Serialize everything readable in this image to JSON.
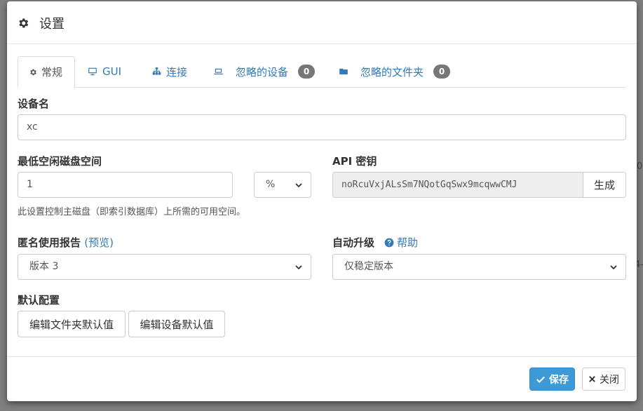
{
  "background": {
    "right_fragment_1": "0",
    "right_fragment_2": "4-"
  },
  "header": {
    "title": "设置"
  },
  "tabs": [
    {
      "label": "常规",
      "icon": "gear-icon"
    },
    {
      "label": "GUI",
      "icon": "desktop-icon"
    },
    {
      "label": "连接",
      "icon": "sitemap-icon"
    },
    {
      "label": "忽略的设备",
      "icon": "laptop-icon",
      "badge": "0"
    },
    {
      "label": "忽略的文件夹",
      "icon": "folder-icon",
      "badge": "0"
    }
  ],
  "general": {
    "device_name_label": "设备名",
    "device_name_value": "xc",
    "min_disk_label": "最低空闲磁盘空间",
    "min_disk_value": "1",
    "min_disk_unit": "%",
    "min_disk_help": "此设置控制主磁盘（即索引数据库）上所需的可用空间。",
    "api_key_label": "API 密钥",
    "api_key_value": "noRcuVxjALsSm7NQotGqSwx9mcqwwCMJ",
    "generate_button": "生成",
    "usage_report_label": "匿名使用报告",
    "usage_report_preview_open": "(",
    "usage_report_preview_link": "预览",
    "usage_report_preview_close": ")",
    "usage_report_value": "版本 3",
    "auto_upgrade_label": "自动升级",
    "help_link": "帮助",
    "auto_upgrade_value": "仅稳定版本",
    "defaults_label": "默认配置",
    "edit_folder_defaults": "编辑文件夹默认值",
    "edit_device_defaults": "编辑设备默认值"
  },
  "footer": {
    "save_label": "保存",
    "close_label": "关闭"
  },
  "colors": {
    "primary": "#3d9ad6",
    "link": "#337ab7",
    "badge": "#777777"
  }
}
